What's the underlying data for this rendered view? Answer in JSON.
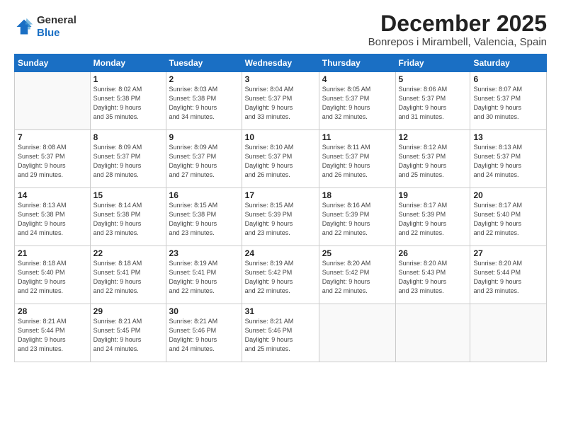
{
  "header": {
    "logo": {
      "line1": "General",
      "line2": "Blue"
    },
    "month": "December 2025",
    "location": "Bonrepos i Mirambell, Valencia, Spain"
  },
  "weekdays": [
    "Sunday",
    "Monday",
    "Tuesday",
    "Wednesday",
    "Thursday",
    "Friday",
    "Saturday"
  ],
  "weeks": [
    [
      {
        "day": "",
        "sunrise": "",
        "sunset": "",
        "daylight": ""
      },
      {
        "day": "1",
        "sunrise": "Sunrise: 8:02 AM",
        "sunset": "Sunset: 5:38 PM",
        "daylight": "Daylight: 9 hours and 35 minutes."
      },
      {
        "day": "2",
        "sunrise": "Sunrise: 8:03 AM",
        "sunset": "Sunset: 5:38 PM",
        "daylight": "Daylight: 9 hours and 34 minutes."
      },
      {
        "day": "3",
        "sunrise": "Sunrise: 8:04 AM",
        "sunset": "Sunset: 5:37 PM",
        "daylight": "Daylight: 9 hours and 33 minutes."
      },
      {
        "day": "4",
        "sunrise": "Sunrise: 8:05 AM",
        "sunset": "Sunset: 5:37 PM",
        "daylight": "Daylight: 9 hours and 32 minutes."
      },
      {
        "day": "5",
        "sunrise": "Sunrise: 8:06 AM",
        "sunset": "Sunset: 5:37 PM",
        "daylight": "Daylight: 9 hours and 31 minutes."
      },
      {
        "day": "6",
        "sunrise": "Sunrise: 8:07 AM",
        "sunset": "Sunset: 5:37 PM",
        "daylight": "Daylight: 9 hours and 30 minutes."
      }
    ],
    [
      {
        "day": "7",
        "sunrise": "Sunrise: 8:08 AM",
        "sunset": "Sunset: 5:37 PM",
        "daylight": "Daylight: 9 hours and 29 minutes."
      },
      {
        "day": "8",
        "sunrise": "Sunrise: 8:09 AM",
        "sunset": "Sunset: 5:37 PM",
        "daylight": "Daylight: 9 hours and 28 minutes."
      },
      {
        "day": "9",
        "sunrise": "Sunrise: 8:09 AM",
        "sunset": "Sunset: 5:37 PM",
        "daylight": "Daylight: 9 hours and 27 minutes."
      },
      {
        "day": "10",
        "sunrise": "Sunrise: 8:10 AM",
        "sunset": "Sunset: 5:37 PM",
        "daylight": "Daylight: 9 hours and 26 minutes."
      },
      {
        "day": "11",
        "sunrise": "Sunrise: 8:11 AM",
        "sunset": "Sunset: 5:37 PM",
        "daylight": "Daylight: 9 hours and 26 minutes."
      },
      {
        "day": "12",
        "sunrise": "Sunrise: 8:12 AM",
        "sunset": "Sunset: 5:37 PM",
        "daylight": "Daylight: 9 hours and 25 minutes."
      },
      {
        "day": "13",
        "sunrise": "Sunrise: 8:13 AM",
        "sunset": "Sunset: 5:37 PM",
        "daylight": "Daylight: 9 hours and 24 minutes."
      }
    ],
    [
      {
        "day": "14",
        "sunrise": "Sunrise: 8:13 AM",
        "sunset": "Sunset: 5:38 PM",
        "daylight": "Daylight: 9 hours and 24 minutes."
      },
      {
        "day": "15",
        "sunrise": "Sunrise: 8:14 AM",
        "sunset": "Sunset: 5:38 PM",
        "daylight": "Daylight: 9 hours and 23 minutes."
      },
      {
        "day": "16",
        "sunrise": "Sunrise: 8:15 AM",
        "sunset": "Sunset: 5:38 PM",
        "daylight": "Daylight: 9 hours and 23 minutes."
      },
      {
        "day": "17",
        "sunrise": "Sunrise: 8:15 AM",
        "sunset": "Sunset: 5:39 PM",
        "daylight": "Daylight: 9 hours and 23 minutes."
      },
      {
        "day": "18",
        "sunrise": "Sunrise: 8:16 AM",
        "sunset": "Sunset: 5:39 PM",
        "daylight": "Daylight: 9 hours and 22 minutes."
      },
      {
        "day": "19",
        "sunrise": "Sunrise: 8:17 AM",
        "sunset": "Sunset: 5:39 PM",
        "daylight": "Daylight: 9 hours and 22 minutes."
      },
      {
        "day": "20",
        "sunrise": "Sunrise: 8:17 AM",
        "sunset": "Sunset: 5:40 PM",
        "daylight": "Daylight: 9 hours and 22 minutes."
      }
    ],
    [
      {
        "day": "21",
        "sunrise": "Sunrise: 8:18 AM",
        "sunset": "Sunset: 5:40 PM",
        "daylight": "Daylight: 9 hours and 22 minutes."
      },
      {
        "day": "22",
        "sunrise": "Sunrise: 8:18 AM",
        "sunset": "Sunset: 5:41 PM",
        "daylight": "Daylight: 9 hours and 22 minutes."
      },
      {
        "day": "23",
        "sunrise": "Sunrise: 8:19 AM",
        "sunset": "Sunset: 5:41 PM",
        "daylight": "Daylight: 9 hours and 22 minutes."
      },
      {
        "day": "24",
        "sunrise": "Sunrise: 8:19 AM",
        "sunset": "Sunset: 5:42 PM",
        "daylight": "Daylight: 9 hours and 22 minutes."
      },
      {
        "day": "25",
        "sunrise": "Sunrise: 8:20 AM",
        "sunset": "Sunset: 5:42 PM",
        "daylight": "Daylight: 9 hours and 22 minutes."
      },
      {
        "day": "26",
        "sunrise": "Sunrise: 8:20 AM",
        "sunset": "Sunset: 5:43 PM",
        "daylight": "Daylight: 9 hours and 23 minutes."
      },
      {
        "day": "27",
        "sunrise": "Sunrise: 8:20 AM",
        "sunset": "Sunset: 5:44 PM",
        "daylight": "Daylight: 9 hours and 23 minutes."
      }
    ],
    [
      {
        "day": "28",
        "sunrise": "Sunrise: 8:21 AM",
        "sunset": "Sunset: 5:44 PM",
        "daylight": "Daylight: 9 hours and 23 minutes."
      },
      {
        "day": "29",
        "sunrise": "Sunrise: 8:21 AM",
        "sunset": "Sunset: 5:45 PM",
        "daylight": "Daylight: 9 hours and 24 minutes."
      },
      {
        "day": "30",
        "sunrise": "Sunrise: 8:21 AM",
        "sunset": "Sunset: 5:46 PM",
        "daylight": "Daylight: 9 hours and 24 minutes."
      },
      {
        "day": "31",
        "sunrise": "Sunrise: 8:21 AM",
        "sunset": "Sunset: 5:46 PM",
        "daylight": "Daylight: 9 hours and 25 minutes."
      },
      {
        "day": "",
        "sunrise": "",
        "sunset": "",
        "daylight": ""
      },
      {
        "day": "",
        "sunrise": "",
        "sunset": "",
        "daylight": ""
      },
      {
        "day": "",
        "sunrise": "",
        "sunset": "",
        "daylight": ""
      }
    ]
  ]
}
